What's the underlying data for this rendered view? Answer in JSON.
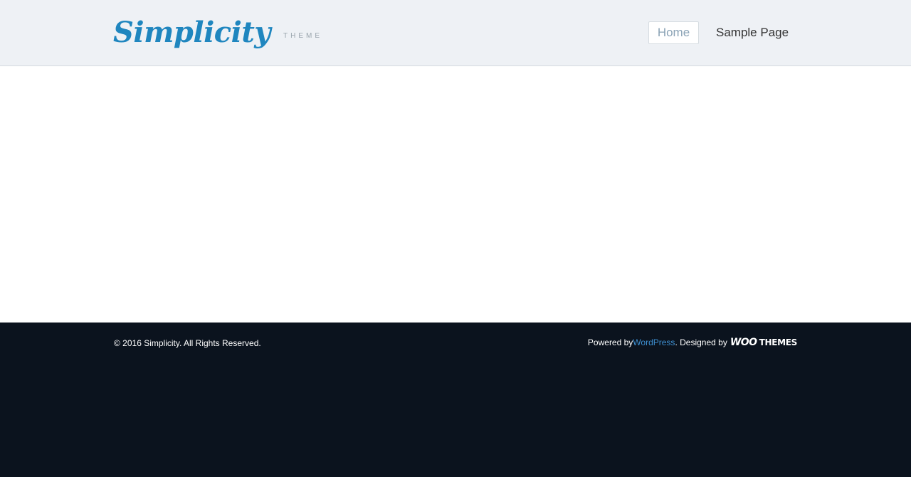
{
  "header": {
    "logo_text": "Simplicity",
    "logo_tagline": "THEME",
    "nav": [
      {
        "label": "Home",
        "active": true
      },
      {
        "label": "Sample Page",
        "active": false
      }
    ]
  },
  "footer": {
    "copyright": "© 2016 Simplicity. All Rights Reserved.",
    "powered_prefix": "Powered by ",
    "powered_link": "WordPress",
    "designed_prefix": ". Designed by ",
    "designer_logo": {
      "woo": "WOO",
      "themes": "THEMES"
    }
  },
  "colors": {
    "brand": "#1f86bf",
    "link": "#3d8fd1",
    "header_bg": "#eef1f5",
    "footer_bg": "#0b131e"
  }
}
